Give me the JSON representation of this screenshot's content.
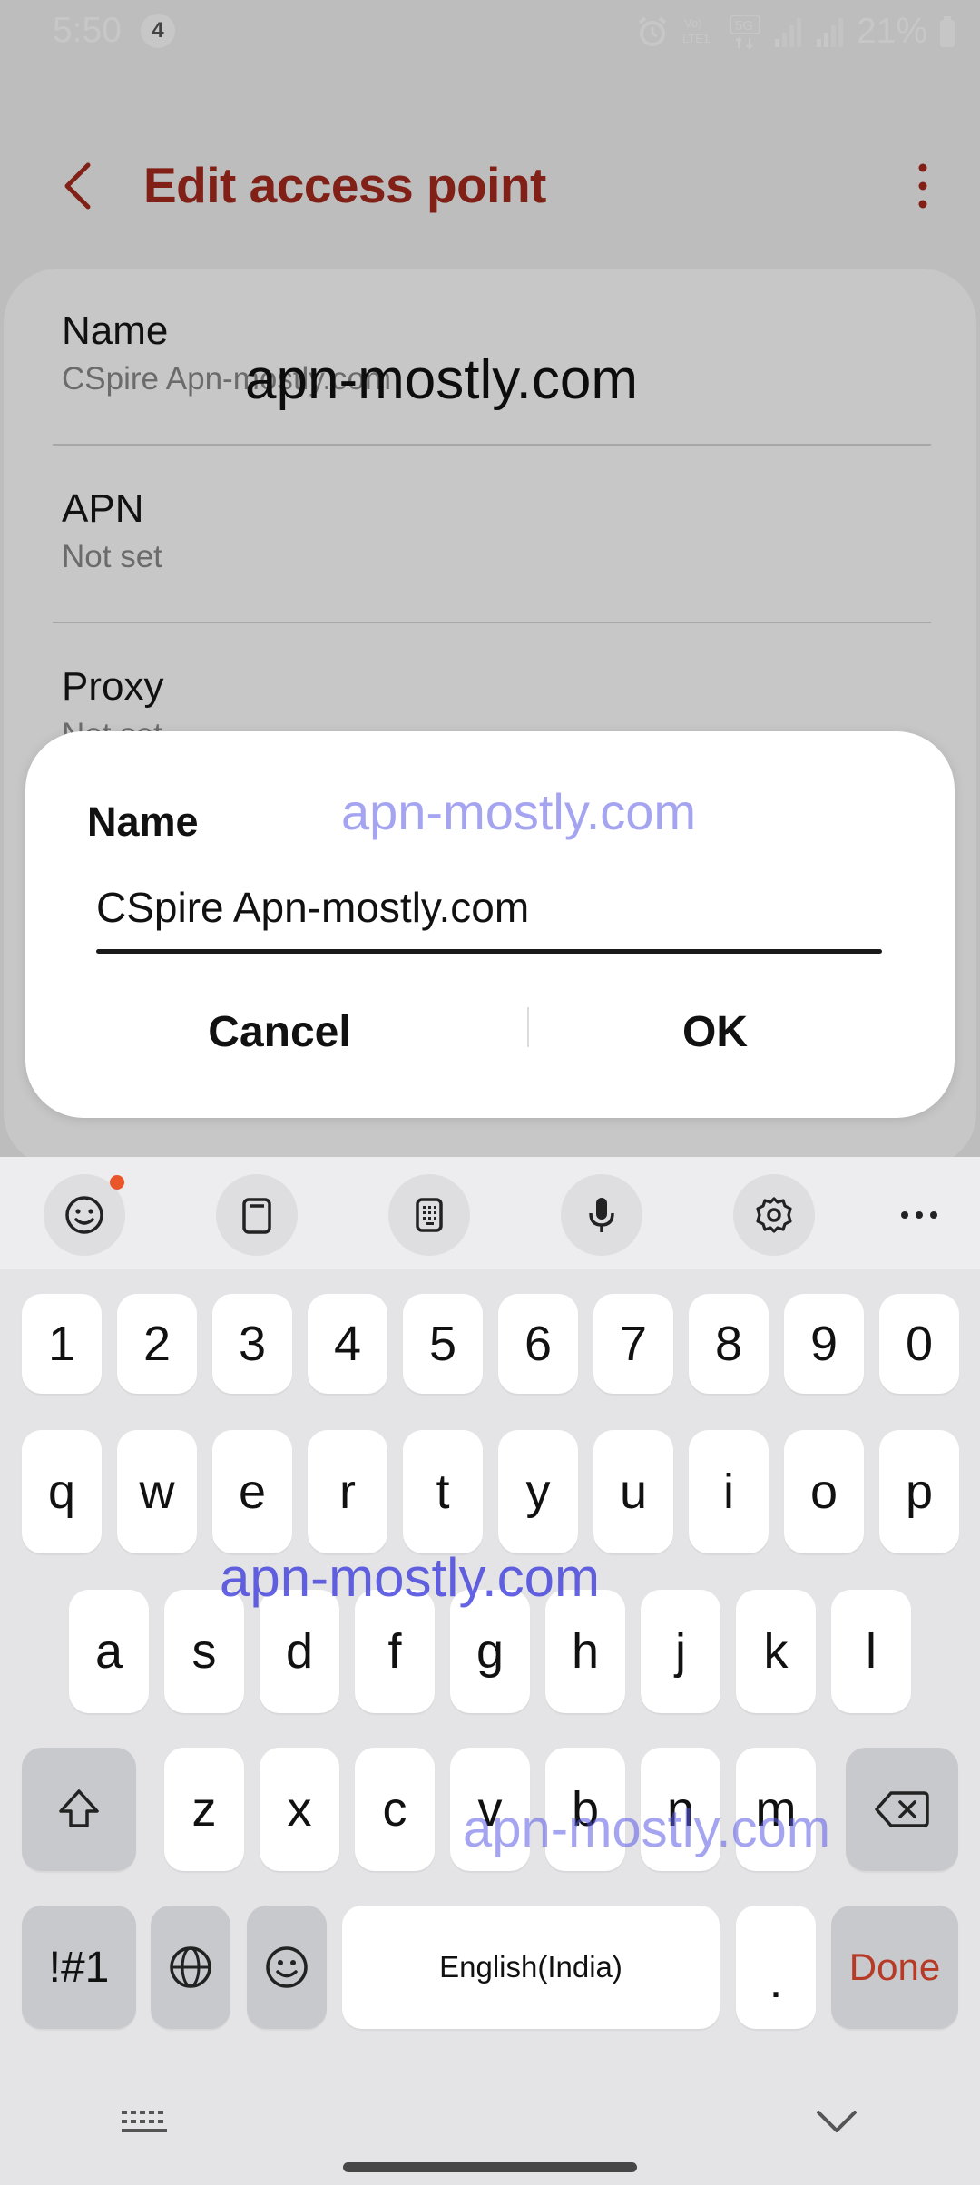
{
  "status_bar": {
    "time": "5:50",
    "notification_count": "4",
    "battery": "21%",
    "icons": [
      "alarm-icon",
      "volte-icon",
      "5g-icon",
      "signal-icon",
      "signal-icon",
      "battery-icon"
    ]
  },
  "app_bar": {
    "title": "Edit access point",
    "back_icon": "back-chevron-icon",
    "more_icon": "more-vertical-icon"
  },
  "settings": [
    {
      "title": "Name",
      "value": "CSpire Apn-mostly.com"
    },
    {
      "title": "APN",
      "value": "Not set"
    },
    {
      "title": "Proxy",
      "value": "Not set"
    }
  ],
  "dialog": {
    "title": "Name",
    "input_value": "CSpire Apn-mostly.com",
    "cancel_label": "Cancel",
    "ok_label": "OK"
  },
  "keyboard": {
    "toolbar_icons": [
      "emoji-icon",
      "clipboard-icon",
      "keyboard-layout-icon",
      "microphone-icon",
      "settings-icon",
      "more-horizontal-icon"
    ],
    "number_row": [
      "1",
      "2",
      "3",
      "4",
      "5",
      "6",
      "7",
      "8",
      "9",
      "0"
    ],
    "row1": [
      "q",
      "w",
      "e",
      "r",
      "t",
      "y",
      "u",
      "i",
      "o",
      "p"
    ],
    "row2": [
      "a",
      "s",
      "d",
      "f",
      "g",
      "h",
      "j",
      "k",
      "l"
    ],
    "row3": [
      "z",
      "x",
      "c",
      "v",
      "b",
      "n",
      "m"
    ],
    "symbols_label": "!#1",
    "space_label": "English(India)",
    "period_label": ".",
    "done_label": "Done"
  },
  "watermarks": [
    "apn-mostly.com",
    "apn-mostly.com",
    "apn-mostly.com",
    "apn-mostly.com"
  ],
  "colors": {
    "accent": "#a52a1d",
    "done": "#b63a26",
    "keyboard_bg": "#e4e4e6",
    "notification_dot": "#e8562a"
  }
}
